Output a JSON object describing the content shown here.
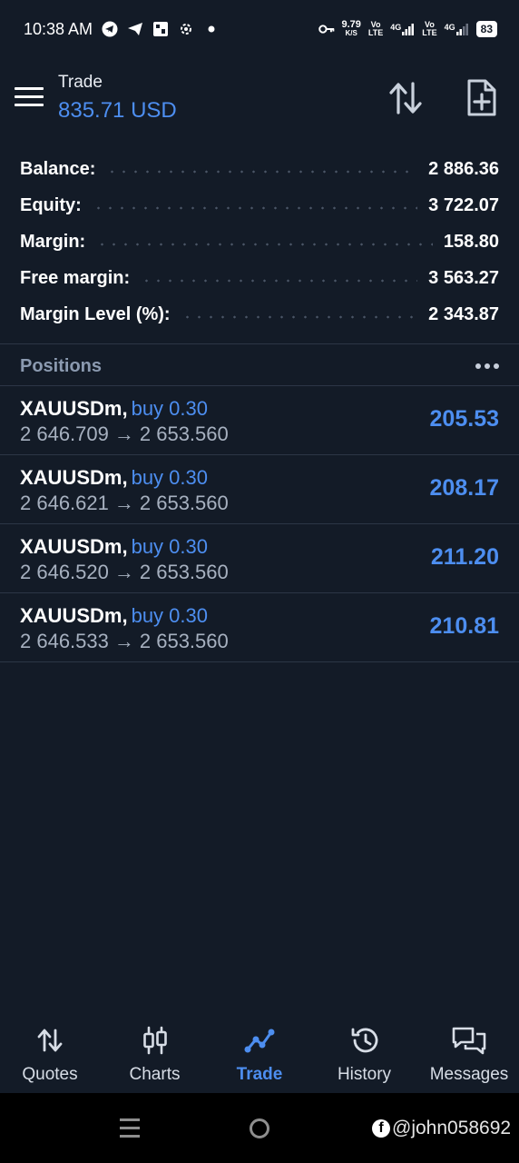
{
  "status_bar": {
    "time": "10:38 AM",
    "net_speed_value": "9.79",
    "net_speed_unit": "K/S",
    "sim1_label_top": "Vo",
    "sim1_label_bottom": "LTE",
    "sim1_net": "4G",
    "sim2_label_top": "Vo",
    "sim2_label_bottom": "LTE",
    "sim2_net": "4G",
    "battery": "83"
  },
  "header": {
    "title": "Trade",
    "balance": "835.71 USD"
  },
  "summary": [
    {
      "label": "Balance:",
      "value": "2 886.36"
    },
    {
      "label": "Equity:",
      "value": "3 722.07"
    },
    {
      "label": "Margin:",
      "value": "158.80"
    },
    {
      "label": "Free margin:",
      "value": "3 563.27"
    },
    {
      "label": "Margin Level (%):",
      "value": "2 343.87"
    }
  ],
  "positions": {
    "title": "Positions",
    "rows": [
      {
        "symbol": "XAUUSDm,",
        "side": "buy 0.30",
        "open_price": "2 646.709",
        "arrow": "→",
        "current_price": "2 653.560",
        "profit": "205.53"
      },
      {
        "symbol": "XAUUSDm,",
        "side": "buy 0.30",
        "open_price": "2 646.621",
        "arrow": "→",
        "current_price": "2 653.560",
        "profit": "208.17"
      },
      {
        "symbol": "XAUUSDm,",
        "side": "buy 0.30",
        "open_price": "2 646.520",
        "arrow": "→",
        "current_price": "2 653.560",
        "profit": "211.20"
      },
      {
        "symbol": "XAUUSDm,",
        "side": "buy 0.30",
        "open_price": "2 646.533",
        "arrow": "→",
        "current_price": "2 653.560",
        "profit": "210.81"
      }
    ]
  },
  "bottom_nav": [
    {
      "label": "Quotes",
      "icon": "quotes-icon"
    },
    {
      "label": "Charts",
      "icon": "charts-icon"
    },
    {
      "label": "Trade",
      "icon": "trade-icon",
      "active": true
    },
    {
      "label": "History",
      "icon": "history-icon"
    },
    {
      "label": "Messages",
      "icon": "messages-icon"
    }
  ],
  "watermark": "@john058692",
  "colors": {
    "background": "#131b27",
    "accent": "#4d8ef0",
    "muted": "#a7b1c0",
    "divider": "#2c3646"
  }
}
